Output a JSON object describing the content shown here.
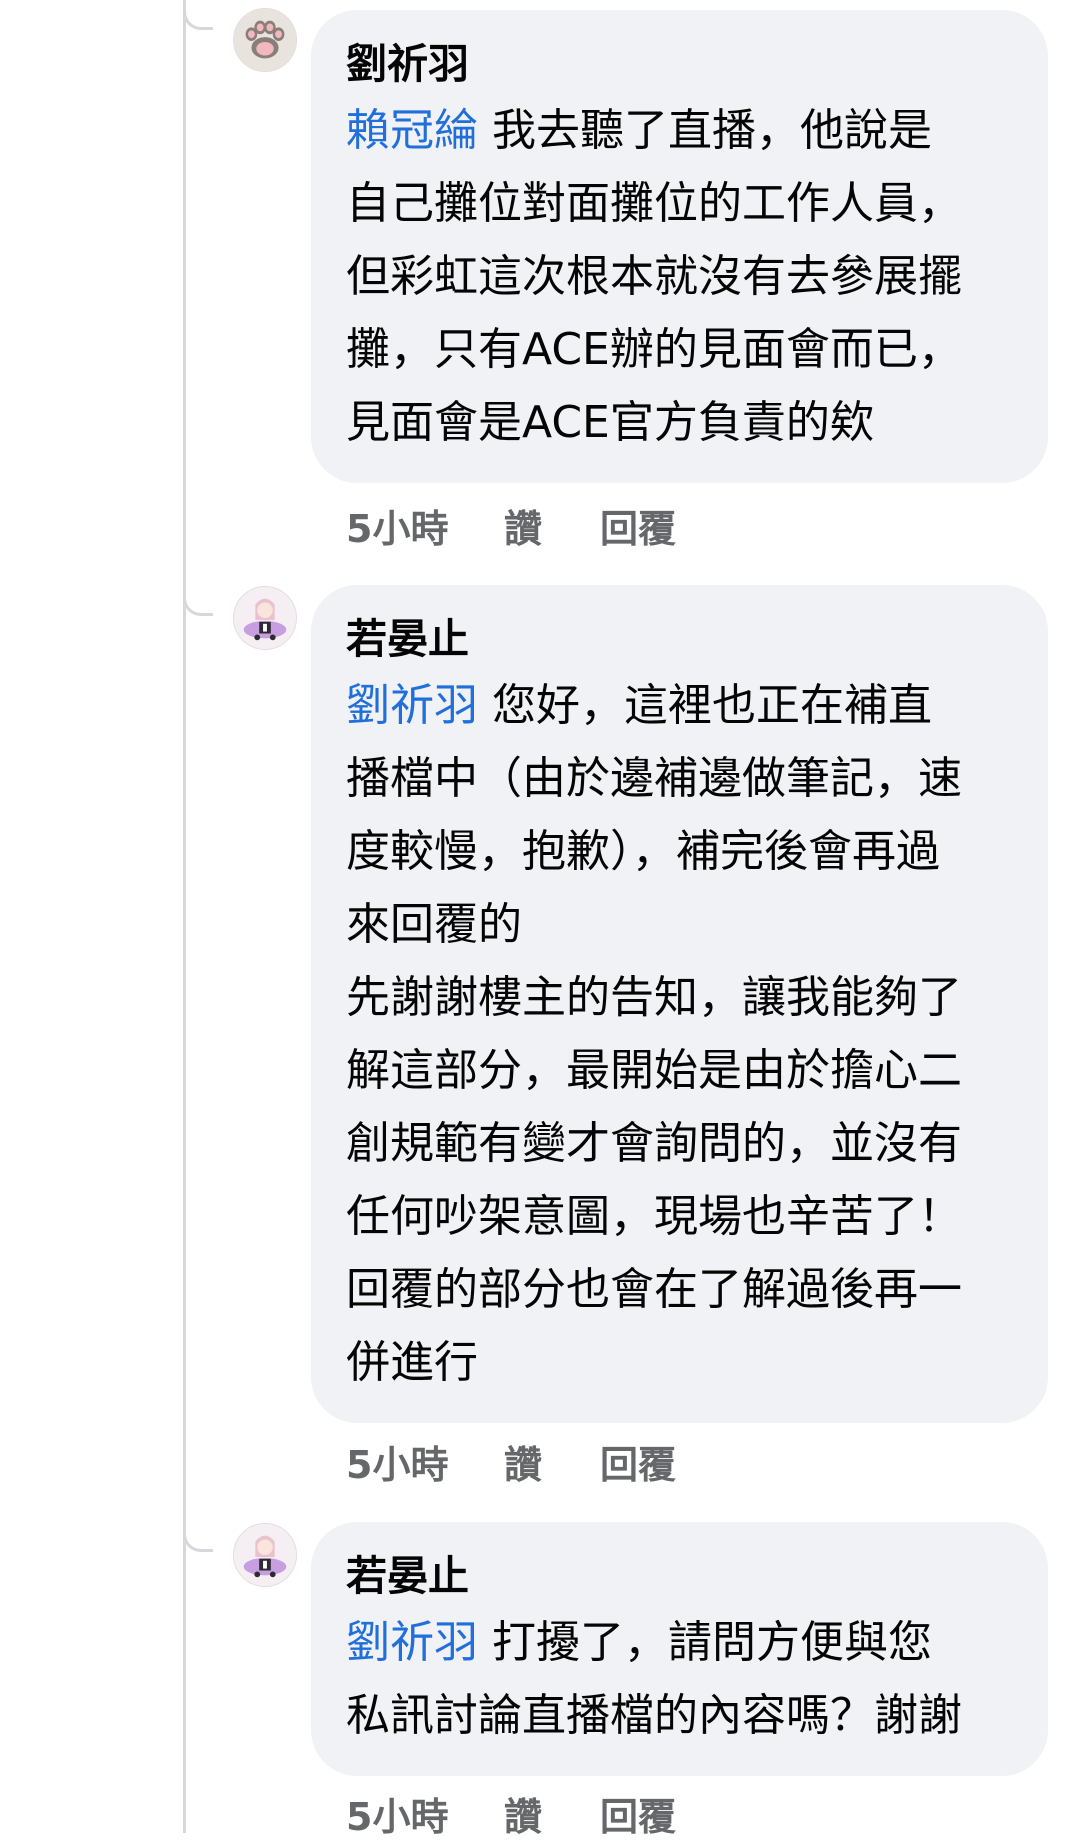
{
  "comments": [
    {
      "avatar": "paw-avatar-icon",
      "author": "劉祈羽",
      "mention": "賴冠綸",
      "lines": [
        " 我去聽了直播，他說是",
        "自己攤位對面攤位的工作人員，",
        "但彩虹這次根本就沒有去參展擺",
        "攤，只有ACE辦的見面會而已，",
        "見面會是ACE官方負責的欸"
      ],
      "time": "5小時",
      "like": "讚",
      "reply": "回覆"
    },
    {
      "avatar": "anime-girl-avatar-icon",
      "author": "若晏止",
      "mention": "劉祈羽",
      "lines": [
        " 您好，這裡也正在補直",
        "播檔中（由於邊補邊做筆記，速",
        "度較慢，抱歉），補完後會再過",
        "來回覆的",
        "先謝謝樓主的告知，讓我能夠了",
        "解這部分，最開始是由於擔心二",
        "創規範有變才會詢問的，並沒有",
        "任何吵架意圖，現場也辛苦了！",
        "回覆的部分也會在了解過後再一",
        "併進行"
      ],
      "time": "5小時",
      "like": "讚",
      "reply": "回覆"
    },
    {
      "avatar": "anime-girl-avatar-icon",
      "author": "若晏止",
      "mention": "劉祈羽",
      "lines": [
        " 打擾了，請問方便與您",
        "私訊討論直播檔的內容嗎？謝謝"
      ],
      "time": "5小時",
      "like": "讚",
      "reply": "回覆"
    }
  ]
}
